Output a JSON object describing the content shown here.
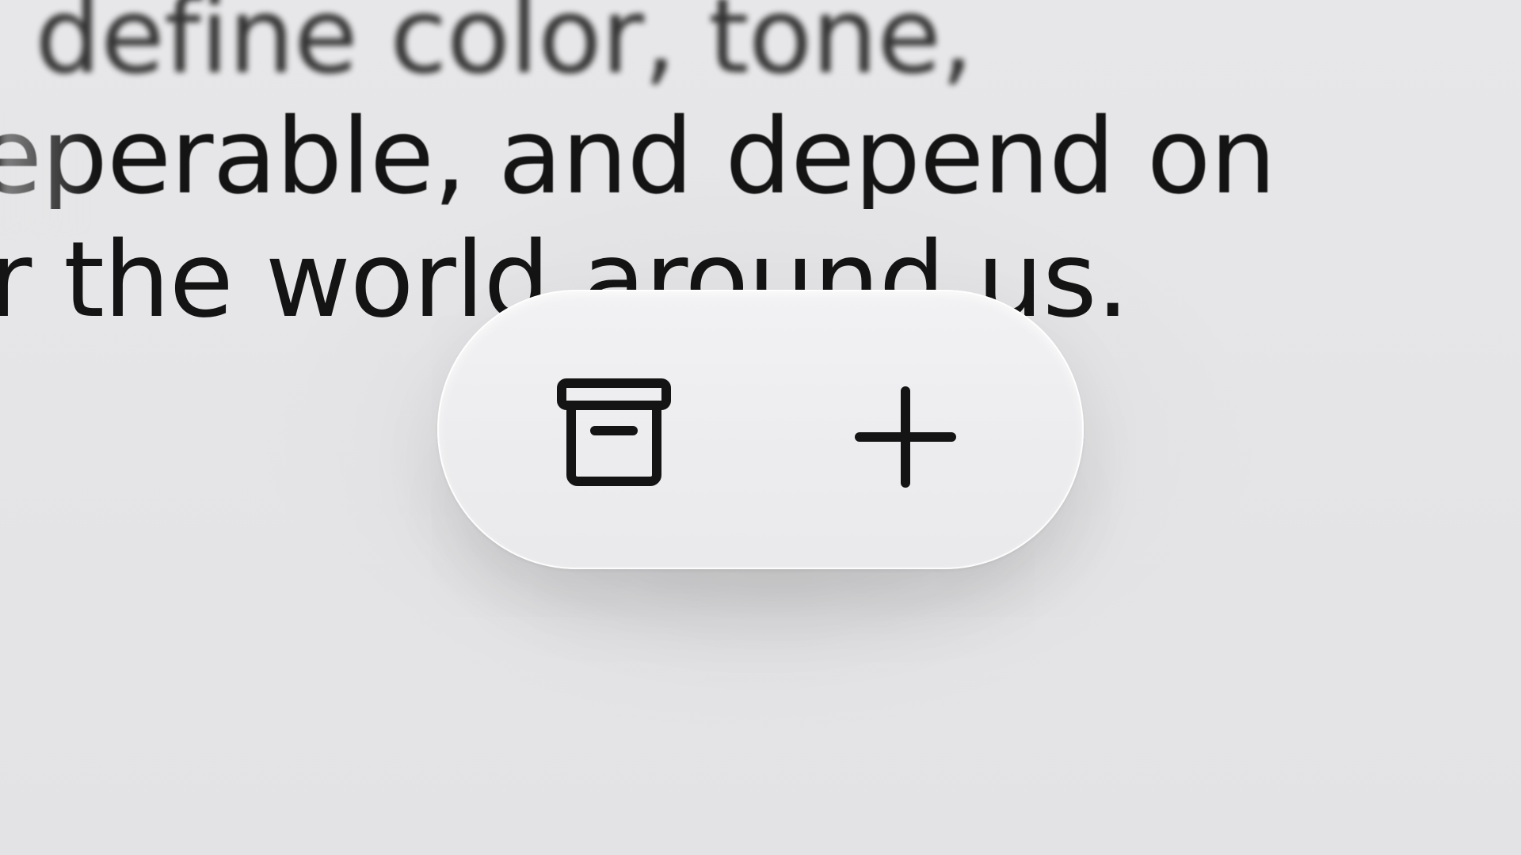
{
  "background_text": {
    "line_1": "define color, tone,",
    "line_2": "eperable, and depend on",
    "line_3": "r the world around us."
  },
  "toolbar": {
    "buttons": [
      {
        "icon": "archive-box-icon"
      },
      {
        "icon": "plus-icon"
      }
    ]
  },
  "colors": {
    "background": "#e5e5e7",
    "toolbar_surface": "#eeeef0",
    "icon_stroke": "#141414",
    "text": "#141414"
  }
}
